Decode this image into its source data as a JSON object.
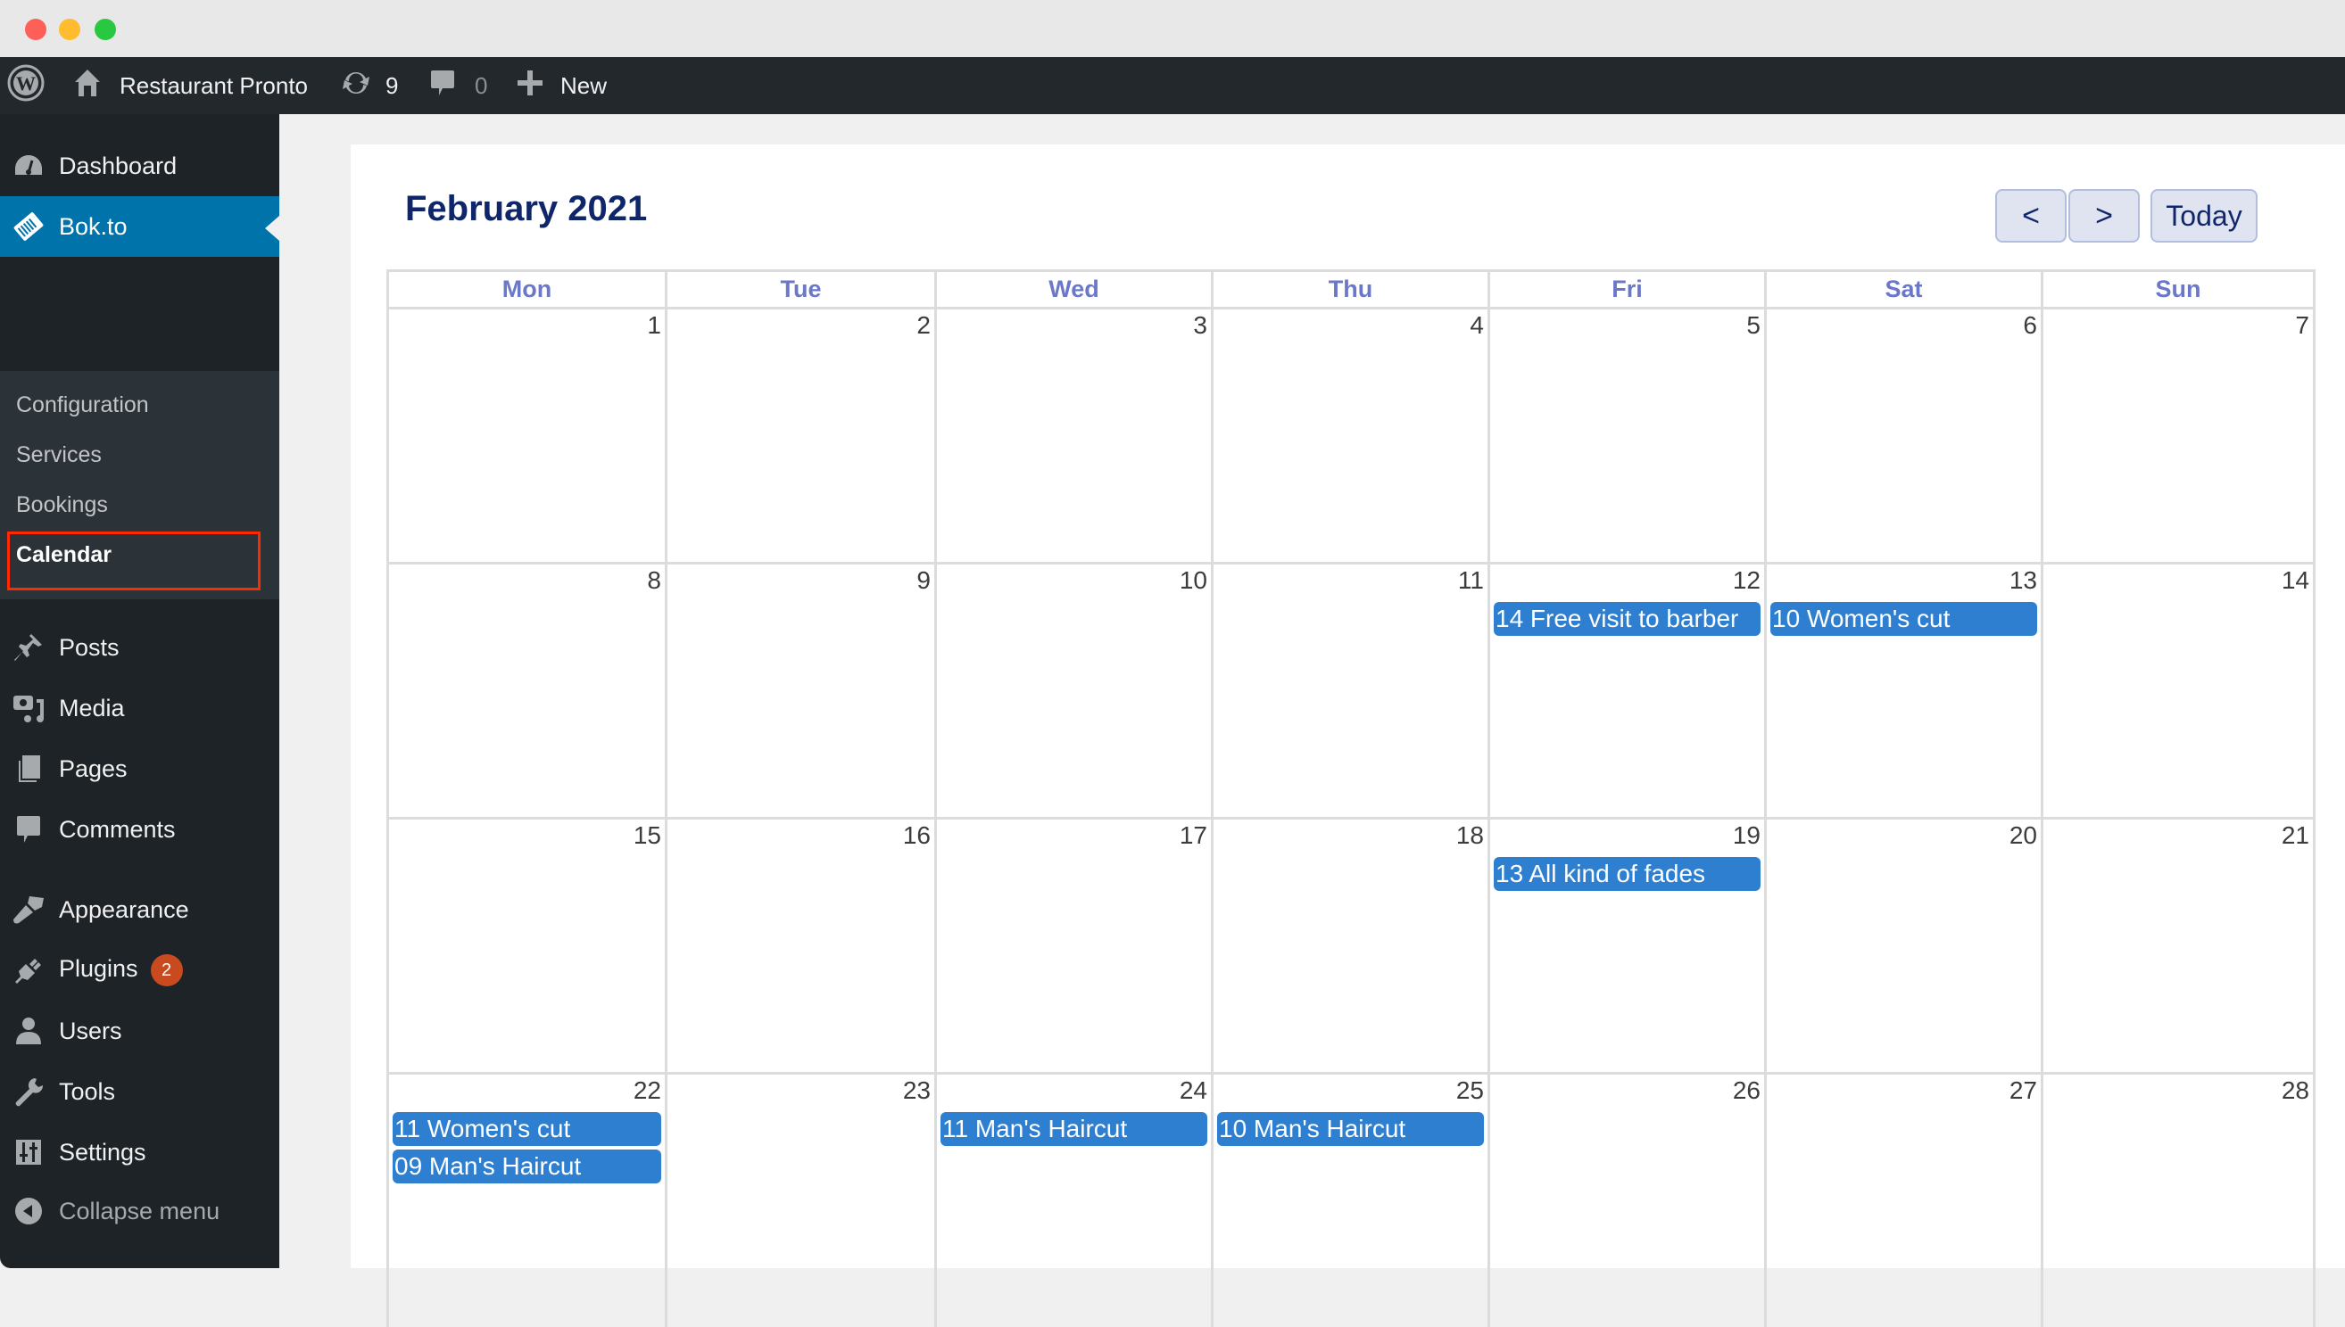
{
  "window": {
    "controls": [
      "close",
      "minimize",
      "maximize"
    ]
  },
  "adminbar": {
    "logo_icon": "wordpress-logo-icon",
    "site_icon": "home-icon",
    "site_name": "Restaurant Pronto",
    "updates_icon": "updates-icon",
    "updates_count": "9",
    "comments_icon": "comment-icon",
    "comments_count": "0",
    "new_icon": "plus-icon",
    "new_label": "New"
  },
  "sidebar": {
    "items": [
      {
        "label": "Dashboard",
        "icon": "dashboard-icon"
      },
      {
        "label": "Bok.to",
        "icon": "ticket-icon",
        "active": true
      },
      {
        "label": "Posts",
        "icon": "pin-icon"
      },
      {
        "label": "Media",
        "icon": "media-icon"
      },
      {
        "label": "Pages",
        "icon": "pages-icon"
      },
      {
        "label": "Comments",
        "icon": "comment-icon"
      },
      {
        "label": "Appearance",
        "icon": "paintbrush-icon"
      },
      {
        "label": "Plugins",
        "icon": "plugin-icon",
        "badge": "2"
      },
      {
        "label": "Users",
        "icon": "user-icon"
      },
      {
        "label": "Tools",
        "icon": "wrench-icon"
      },
      {
        "label": "Settings",
        "icon": "settings-icon"
      },
      {
        "label": "Collapse menu",
        "icon": "collapse-icon"
      }
    ],
    "submenu": [
      {
        "label": "Configuration"
      },
      {
        "label": "Services"
      },
      {
        "label": "Bookings"
      },
      {
        "label": "Calendar",
        "current": true
      }
    ]
  },
  "calendar": {
    "title": "February 2021",
    "prev_label": "<",
    "next_label": ">",
    "today_label": "Today",
    "weekdays": [
      "Mon",
      "Tue",
      "Wed",
      "Thu",
      "Fri",
      "Sat",
      "Sun"
    ],
    "weeks": [
      [
        {
          "day": "1",
          "events": []
        },
        {
          "day": "2",
          "events": []
        },
        {
          "day": "3",
          "events": []
        },
        {
          "day": "4",
          "events": []
        },
        {
          "day": "5",
          "events": []
        },
        {
          "day": "6",
          "events": []
        },
        {
          "day": "7",
          "events": []
        }
      ],
      [
        {
          "day": "8",
          "events": []
        },
        {
          "day": "9",
          "events": []
        },
        {
          "day": "10",
          "events": []
        },
        {
          "day": "11",
          "events": []
        },
        {
          "day": "12",
          "events": [
            "14 Free visit to barber"
          ]
        },
        {
          "day": "13",
          "events": [
            "10 Women's cut"
          ]
        },
        {
          "day": "14",
          "events": []
        }
      ],
      [
        {
          "day": "15",
          "events": []
        },
        {
          "day": "16",
          "events": []
        },
        {
          "day": "17",
          "events": []
        },
        {
          "day": "18",
          "events": []
        },
        {
          "day": "19",
          "events": [
            "13 All kind of fades"
          ]
        },
        {
          "day": "20",
          "events": []
        },
        {
          "day": "21",
          "events": []
        }
      ],
      [
        {
          "day": "22",
          "events": [
            "11 Women's cut",
            "09 Man's Haircut"
          ]
        },
        {
          "day": "23",
          "events": []
        },
        {
          "day": "24",
          "events": [
            "11 Man's Haircut"
          ]
        },
        {
          "day": "25",
          "events": [
            "10 Man's Haircut"
          ]
        },
        {
          "day": "26",
          "events": []
        },
        {
          "day": "27",
          "events": []
        },
        {
          "day": "28",
          "events": []
        }
      ]
    ],
    "event_color": "#2f7fd0",
    "title_color": "#10266a",
    "weekday_color": "#6b77c9"
  },
  "colors": {
    "sidebar_bg": "#1d2327",
    "sidebar_active": "#0073aa",
    "highlight_outline": "#ff2a00",
    "badge": "#ca4a1f"
  }
}
